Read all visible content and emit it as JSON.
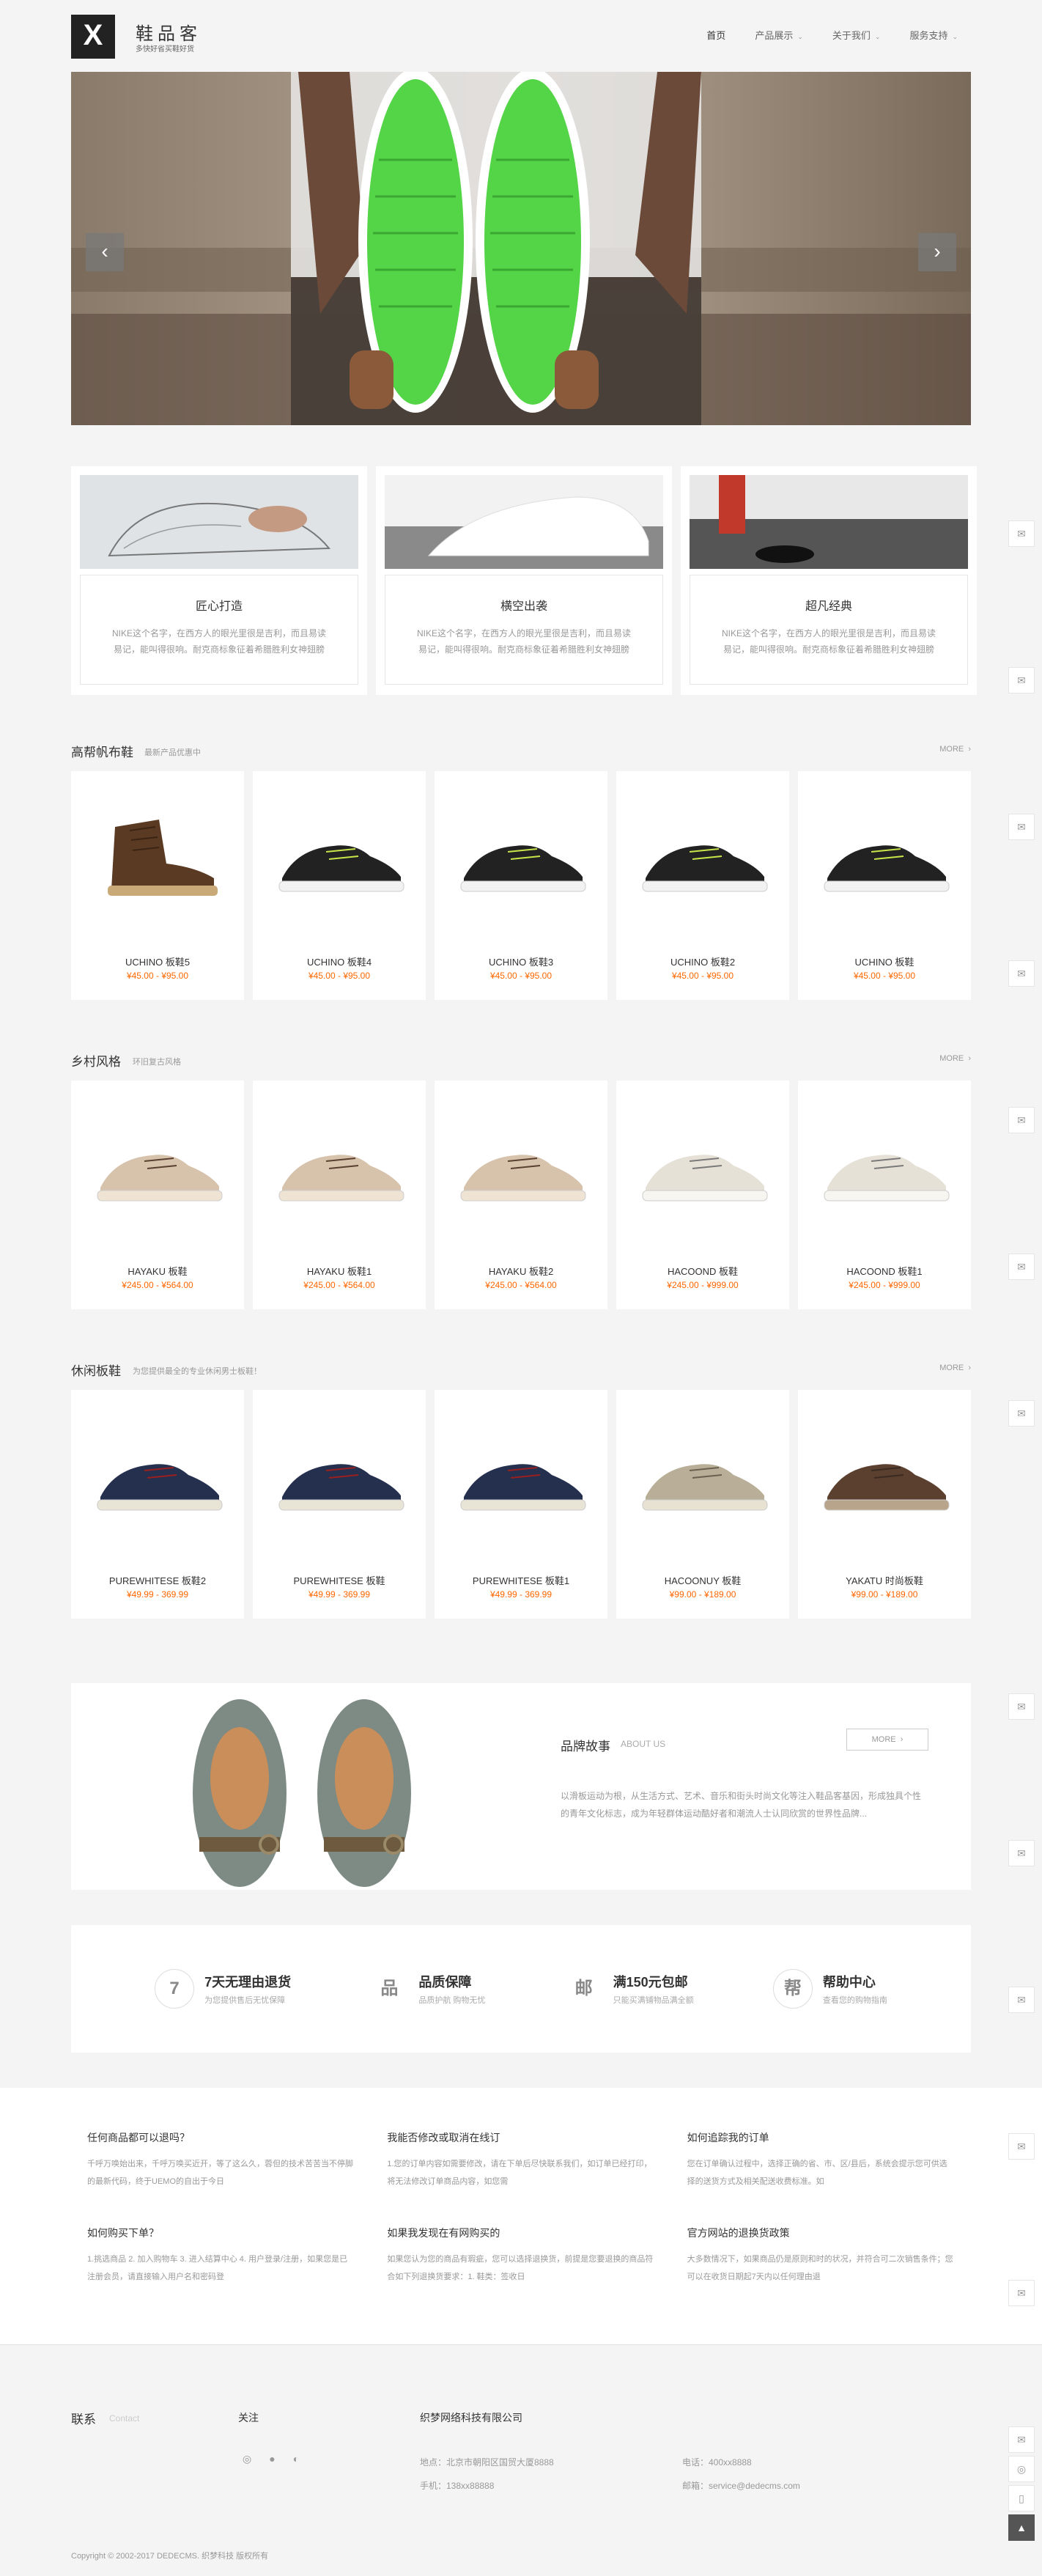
{
  "header": {
    "logo_mark": "X",
    "site_title": "鞋品客",
    "site_subtitle": "多快好省买鞋好货",
    "nav": [
      {
        "label": "首页",
        "active": true
      },
      {
        "label": "产品展示",
        "dropdown": true
      },
      {
        "label": "关于我们",
        "dropdown": true
      },
      {
        "label": "服务支持",
        "dropdown": true
      }
    ]
  },
  "banner": {
    "prev": "‹",
    "next": "›"
  },
  "features": [
    {
      "title": "匠心打造",
      "desc": "NIKE这个名字，在西方人的眼光里很是吉利，而且易读易记，能叫得很响。耐克商标象征着希腊胜利女神翅膀"
    },
    {
      "title": "横空出袭",
      "desc": "NIKE这个名字，在西方人的眼光里很是吉利，而且易读易记，能叫得很响。耐克商标象征着希腊胜利女神翅膀"
    },
    {
      "title": "超凡经典",
      "desc": "NIKE这个名字，在西方人的眼光里很是吉利，而且易读易记，能叫得很响。耐克商标象征着希腊胜利女神翅膀"
    }
  ],
  "sections": [
    {
      "title": "高帮帆布鞋",
      "sub": "最新产品优惠中",
      "more": "MORE",
      "products": [
        {
          "name": "UCHINO 板鞋5",
          "price": "¥45.00 - ¥95.00",
          "style": "boot"
        },
        {
          "name": "UCHINO 板鞋4",
          "price": "¥45.00 - ¥95.00",
          "style": "black"
        },
        {
          "name": "UCHINO 板鞋3",
          "price": "¥45.00 - ¥95.00",
          "style": "black"
        },
        {
          "name": "UCHINO 板鞋2",
          "price": "¥45.00 - ¥95.00",
          "style": "black"
        },
        {
          "name": "UCHINO 板鞋",
          "price": "¥45.00 - ¥95.00",
          "style": "black"
        }
      ]
    },
    {
      "title": "乡村风格",
      "sub": "环旧复古风格",
      "more": "MORE",
      "products": [
        {
          "name": "HAYAKU 板鞋",
          "price": "¥245.00 - ¥564.00",
          "style": "tan"
        },
        {
          "name": "HAYAKU 板鞋1",
          "price": "¥245.00 - ¥564.00",
          "style": "tan"
        },
        {
          "name": "HAYAKU 板鞋2",
          "price": "¥245.00 - ¥564.00",
          "style": "tan"
        },
        {
          "name": "HACOOND 板鞋",
          "price": "¥245.00 - ¥999.00",
          "style": "white"
        },
        {
          "name": "HACOOND 板鞋1",
          "price": "¥245.00 - ¥999.00",
          "style": "white"
        }
      ]
    },
    {
      "title": "休闲板鞋",
      "sub": "为您提供最全的专业休闲男士板鞋！",
      "more": "MORE",
      "products": [
        {
          "name": "PUREWHITESE 板鞋2",
          "price": "¥49.99 - 369.99",
          "style": "navy"
        },
        {
          "name": "PUREWHITESE 板鞋",
          "price": "¥49.99 - 369.99",
          "style": "navy"
        },
        {
          "name": "PUREWHITESE 板鞋1",
          "price": "¥49.99 - 369.99",
          "style": "navy"
        },
        {
          "name": "HACOONUY 板鞋",
          "price": "¥99.00 - ¥189.00",
          "style": "beige"
        },
        {
          "name": "YAKATU 时尚板鞋",
          "price": "¥99.00 - ¥189.00",
          "style": "brown"
        }
      ]
    }
  ],
  "brand": {
    "title": "品牌故事",
    "sub": "ABOUT US",
    "more": "MORE",
    "desc": "以滑板运动为根，从生活方式、艺术、音乐和街头时尚文化等注入鞋品客基因，形成独具个性的青年文化标志，成为年轻群体运动酷好者和潮流人士认同欣赏的世界性品牌..."
  },
  "services": [
    {
      "icon": "7",
      "title": "7天无理由退货",
      "desc": "为您提供售后无忧保障"
    },
    {
      "icon": "品",
      "title": "品质保障",
      "desc": "品质护航 购物无忧"
    },
    {
      "icon": "邮",
      "title": "满150元包邮",
      "desc": "只能买满铺物品满全额"
    },
    {
      "icon": "帮",
      "title": "帮助中心",
      "desc": "查看您的购物指南"
    }
  ],
  "faq": [
    {
      "q": "任何商品都可以退吗？",
      "a": "千呼万唤始出来，千呼万唤买近开，等了这么久，蓉但的技术苦苦当不停脚的最新代码，终于UEMO的自出于今日"
    },
    {
      "q": "我能否修改或取消在线订",
      "a": "1.您的订单内容如需要修改，请在下单后尽快联系我们，如订单已经打印，将无法修改订单商品内容，如您需"
    },
    {
      "q": "如何追踪我的订单",
      "a": "您在订单确认过程中，选择正确的省、市、区/县后，系统会提示您可供选择的送货方式及相关配送收费标准。如"
    },
    {
      "q": "如何购买下单？",
      "a": "1.挑选商品 2. 加入购物车 3. 进入结算中心 4. 用户登录/注册，如果您是已注册会员，请直接输入用户名和密码登"
    },
    {
      "q": "如果我发现在有网购买的",
      "a": "如果您认为您的商品有瑕疵，您可以选择退换货，前提是您要退换的商品符合如下列退换货要求：1. 鞋类：签收日"
    },
    {
      "q": "官方网站的退换货政策",
      "a": "大多数情况下，如果商品仍是原则和时的状况，并符合可二次销售条件；您可以在收货日期起7天内以任何理由退"
    }
  ],
  "footer": {
    "contact": "联系",
    "contact_sub": "Contact",
    "follow": "关注",
    "company": "织梦网络科技有限公司",
    "address": "地点：北京市朝阳区国贸大厦8888",
    "phone": "电话：400xx8888",
    "mobile": "手机：138xx88888",
    "email": "邮箱：service@dedecms.com",
    "copyright": "Copyright © 2002-2017 DEDECMS. 织梦科技 版权所有"
  }
}
